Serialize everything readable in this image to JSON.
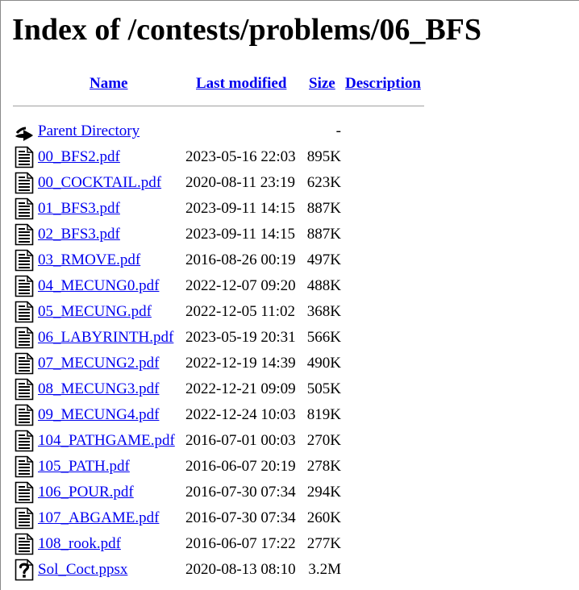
{
  "title": "Index of /contests/problems/06_BFS",
  "columns": {
    "name": "Name",
    "last_modified": "Last modified",
    "size": "Size",
    "description": "Description"
  },
  "parent": {
    "name": "Parent Directory",
    "size": "-",
    "icon": "back-icon"
  },
  "files": [
    {
      "name": "00_BFS2.pdf",
      "modified": "2023-05-16 22:03",
      "size": "895K",
      "icon": "document-icon"
    },
    {
      "name": "00_COCKTAIL.pdf",
      "modified": "2020-08-11 23:19",
      "size": "623K",
      "icon": "document-icon"
    },
    {
      "name": "01_BFS3.pdf",
      "modified": "2023-09-11 14:15",
      "size": "887K",
      "icon": "document-icon"
    },
    {
      "name": "02_BFS3.pdf",
      "modified": "2023-09-11 14:15",
      "size": "887K",
      "icon": "document-icon"
    },
    {
      "name": "03_RMOVE.pdf",
      "modified": "2016-08-26 00:19",
      "size": "497K",
      "icon": "document-icon"
    },
    {
      "name": "04_MECUNG0.pdf",
      "modified": "2022-12-07 09:20",
      "size": "488K",
      "icon": "document-icon"
    },
    {
      "name": "05_MECUNG.pdf",
      "modified": "2022-12-05 11:02",
      "size": "368K",
      "icon": "document-icon"
    },
    {
      "name": "06_LABYRINTH.pdf",
      "modified": "2023-05-19 20:31",
      "size": "566K",
      "icon": "document-icon"
    },
    {
      "name": "07_MECUNG2.pdf",
      "modified": "2022-12-19 14:39",
      "size": "490K",
      "icon": "document-icon"
    },
    {
      "name": "08_MECUNG3.pdf",
      "modified": "2022-12-21 09:09",
      "size": "505K",
      "icon": "document-icon"
    },
    {
      "name": "09_MECUNG4.pdf",
      "modified": "2022-12-24 10:03",
      "size": "819K",
      "icon": "document-icon"
    },
    {
      "name": "104_PATHGAME.pdf",
      "modified": "2016-07-01 00:03",
      "size": "270K",
      "icon": "document-icon"
    },
    {
      "name": "105_PATH.pdf",
      "modified": "2016-06-07 20:19",
      "size": "278K",
      "icon": "document-icon"
    },
    {
      "name": "106_POUR.pdf",
      "modified": "2016-07-30 07:34",
      "size": "294K",
      "icon": "document-icon"
    },
    {
      "name": "107_ABGAME.pdf",
      "modified": "2016-07-30 07:34",
      "size": "260K",
      "icon": "document-icon"
    },
    {
      "name": "108_rook.pdf",
      "modified": "2016-06-07 17:22",
      "size": "277K",
      "icon": "document-icon"
    },
    {
      "name": "Sol_Coct.ppsx",
      "modified": "2020-08-13 08:10",
      "size": "3.2M",
      "icon": "unknown-file-icon"
    }
  ]
}
